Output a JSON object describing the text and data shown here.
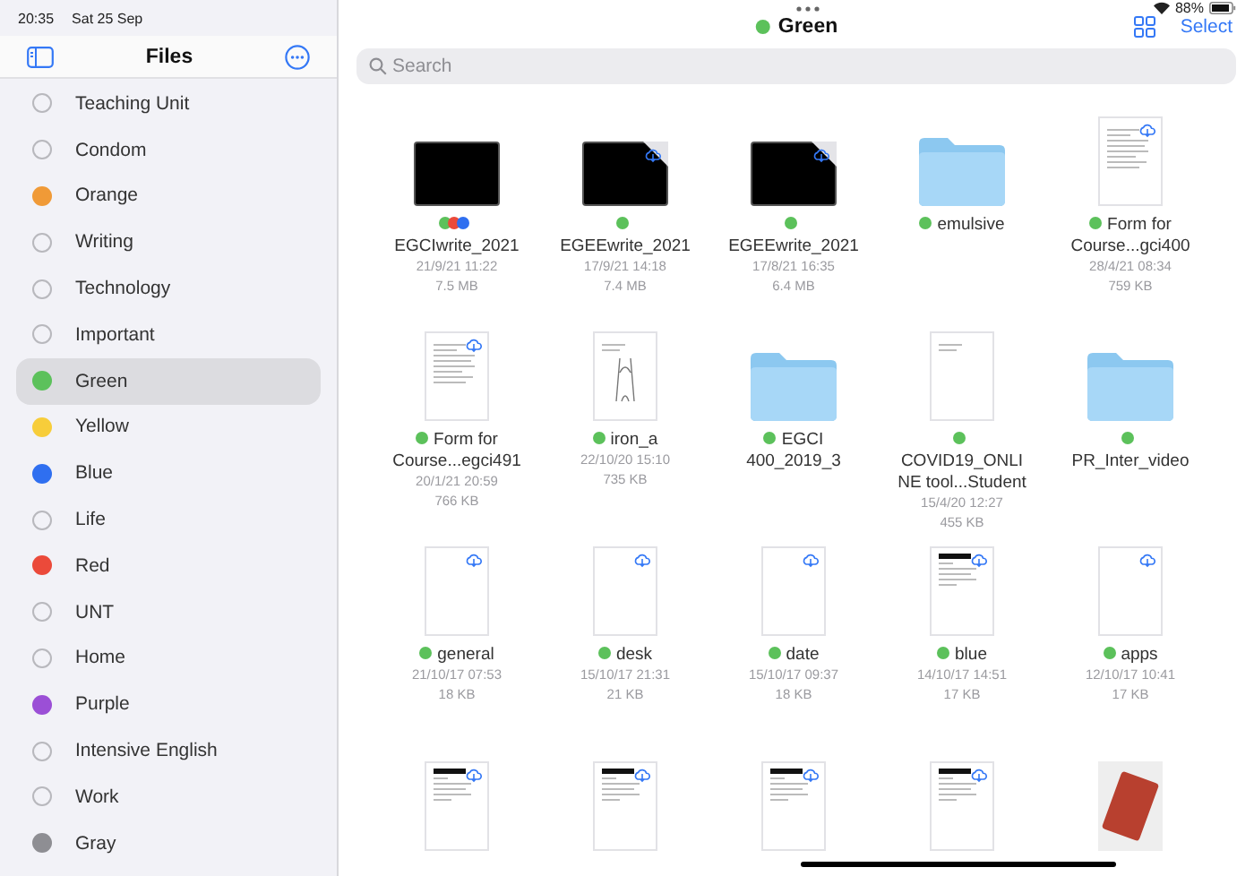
{
  "status_bar": {
    "time": "20:35",
    "date": "Sat 25 Sep",
    "battery": "88%"
  },
  "sidebar": {
    "title": "Files",
    "items": [
      {
        "label": "Teaching Unit",
        "selected": false
      },
      {
        "label": "Condom",
        "selected": false
      },
      {
        "label": "Orange",
        "color": "#f09a37",
        "selected": false
      },
      {
        "label": "Writing",
        "selected": false
      },
      {
        "label": "Technology",
        "selected": false
      },
      {
        "label": "Important",
        "selected": false
      },
      {
        "label": "Green",
        "color": "#5cc15b",
        "selected": true
      },
      {
        "label": "Yellow",
        "color": "#f7cd3a",
        "selected": false
      },
      {
        "label": "Blue",
        "color": "#2f6ff0",
        "selected": false
      },
      {
        "label": "Life",
        "selected": false
      },
      {
        "label": "Red",
        "color": "#eb4a3a",
        "selected": false
      },
      {
        "label": "UNT",
        "selected": false
      },
      {
        "label": "Home",
        "selected": false
      },
      {
        "label": "Purple",
        "color": "#9b4fd6",
        "selected": false
      },
      {
        "label": "Intensive English",
        "selected": false
      },
      {
        "label": "Work",
        "selected": false
      },
      {
        "label": "Gray",
        "color": "#8e8e93",
        "selected": false
      }
    ]
  },
  "main": {
    "title": {
      "text": "Green",
      "color": "#5cc15b"
    },
    "action": "Select",
    "search": {
      "placeholder": "Search"
    },
    "files": [
      {
        "kind": "video",
        "name": "EGCIwrite_2021",
        "date": "21/9/21 11:22",
        "size": "7.5 MB",
        "cloud": false,
        "tags": [
          {
            "color": "#5cc15b"
          },
          {
            "color": "#eb4a3a"
          },
          {
            "color": "#2f6ff0"
          }
        ]
      },
      {
        "kind": "video",
        "name": "EGEEwrite_2021",
        "date": "17/9/21 14:18",
        "size": "7.4 MB",
        "cloud": true,
        "tags": [
          {
            "color": "#5cc15b"
          }
        ]
      },
      {
        "kind": "video",
        "name": "EGEEwrite_2021",
        "date": "17/8/21 16:35",
        "size": "6.4 MB",
        "cloud": true,
        "tags": [
          {
            "color": "#5cc15b"
          }
        ]
      },
      {
        "kind": "folder",
        "name": "emulsive",
        "cloud": false,
        "tags": [
          {
            "color": "#5cc15b"
          }
        ]
      },
      {
        "kind": "form",
        "name": "Form for Course...gci400",
        "date": "28/4/21 08:34",
        "size": "759 KB",
        "cloud": true,
        "tags": [
          {
            "color": "#5cc15b"
          }
        ]
      },
      {
        "kind": "form",
        "name": "Form for Course...egci491",
        "date": "20/1/21 20:59",
        "size": "766 KB",
        "cloud": true,
        "tags": [
          {
            "color": "#5cc15b"
          }
        ]
      },
      {
        "kind": "sketch",
        "name": "iron_a",
        "date": "22/10/20 15:10",
        "size": "735 KB",
        "cloud": false,
        "tags": [
          {
            "color": "#5cc15b"
          }
        ]
      },
      {
        "kind": "folder",
        "name": "EGCI 400_2019_3",
        "cloud": false,
        "tags": [
          {
            "color": "#5cc15b"
          }
        ]
      },
      {
        "kind": "note",
        "name": "COVID19_ONLINE tool...Student",
        "date": "15/4/20 12:27",
        "size": "455 KB",
        "cloud": false,
        "tags": [
          {
            "color": "#5cc15b"
          }
        ]
      },
      {
        "kind": "folder",
        "name": "PR_Inter_video",
        "cloud": false,
        "tags": [
          {
            "color": "#5cc15b"
          }
        ]
      },
      {
        "kind": "blank",
        "name": "general",
        "date": "21/10/17 07:53",
        "size": "18 KB",
        "cloud": true,
        "tags": [
          {
            "color": "#5cc15b"
          }
        ]
      },
      {
        "kind": "blank",
        "name": "desk",
        "date": "15/10/17 21:31",
        "size": "21 KB",
        "cloud": true,
        "tags": [
          {
            "color": "#5cc15b"
          }
        ]
      },
      {
        "kind": "blank",
        "name": "date",
        "date": "15/10/17 09:37",
        "size": "18 KB",
        "cloud": true,
        "tags": [
          {
            "color": "#5cc15b"
          }
        ]
      },
      {
        "kind": "letter",
        "name": "blue",
        "date": "14/10/17 14:51",
        "size": "17 KB",
        "cloud": true,
        "tags": [
          {
            "color": "#5cc15b"
          }
        ]
      },
      {
        "kind": "blank",
        "name": "apps",
        "date": "12/10/17 10:41",
        "size": "17 KB",
        "cloud": true,
        "tags": [
          {
            "color": "#5cc15b"
          }
        ]
      },
      {
        "kind": "letter",
        "cloud": true
      },
      {
        "kind": "letter",
        "cloud": true
      },
      {
        "kind": "letter",
        "cloud": true
      },
      {
        "kind": "letter",
        "cloud": true
      },
      {
        "kind": "photo",
        "cloud": false
      }
    ]
  }
}
